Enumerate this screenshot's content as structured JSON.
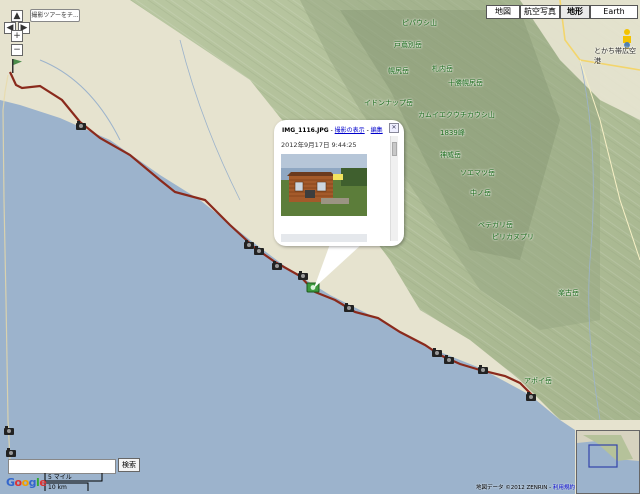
{
  "map_types": [
    {
      "label": "地図",
      "active": false
    },
    {
      "label": "航空写真",
      "active": false
    },
    {
      "label": "地形",
      "active": true
    },
    {
      "label": "Earth",
      "active": false
    }
  ],
  "controls": {
    "zoom_in": "+",
    "zoom_out": "−",
    "tour_button": "撮影ツアーをチ..."
  },
  "place_labels": [
    {
      "text": "ピパウシ山",
      "color": "green"
    },
    {
      "text": "戸蔦別岳",
      "color": "green"
    },
    {
      "text": "幌尻岳",
      "color": "green"
    },
    {
      "text": "札内岳",
      "color": "green"
    },
    {
      "text": "十勝幌尻岳",
      "color": "green"
    },
    {
      "text": "イドンナップ岳",
      "color": "green"
    },
    {
      "text": "カムイエクウチカウシ山",
      "color": "green"
    },
    {
      "text": "神威岳",
      "color": "green"
    },
    {
      "text": "ピリカヌプリ",
      "color": "green"
    },
    {
      "text": "楽古岳",
      "color": "green"
    },
    {
      "text": "とかち帯広空港",
      "color": "dark"
    },
    {
      "text": "アポイ岳",
      "color": "green"
    },
    {
      "text": "ソエマツ岳",
      "color": "green"
    },
    {
      "text": "中ノ岳",
      "color": "green"
    },
    {
      "text": "ペテガリ岳",
      "color": "green"
    },
    {
      "text": "1839峰",
      "color": "green"
    }
  ],
  "info_window": {
    "filename": "IMG_1116.JPG",
    "separator": " - ",
    "link_view": "撮影の表示",
    "link_edit": "編集",
    "timestamp": "2012年9月17日 9:44:25",
    "close_icon": "close-icon"
  },
  "search": {
    "value": "",
    "button_label": "検索"
  },
  "scale": {
    "miles": "5 マイル",
    "km": "10 km"
  },
  "logo": {
    "g": "G",
    "o1": "o",
    "o2": "o",
    "g2": "g",
    "l": "l",
    "e": "e"
  },
  "copyright": {
    "text": "地図データ ©2012 ZENRIN - ",
    "link": "利用規約"
  },
  "colors": {
    "sea": "#9cb3cc",
    "land": "#e8e4d2",
    "mountain": "#c8d3b0",
    "route": "#8a2a1c",
    "accent_link": "#0000cc"
  }
}
